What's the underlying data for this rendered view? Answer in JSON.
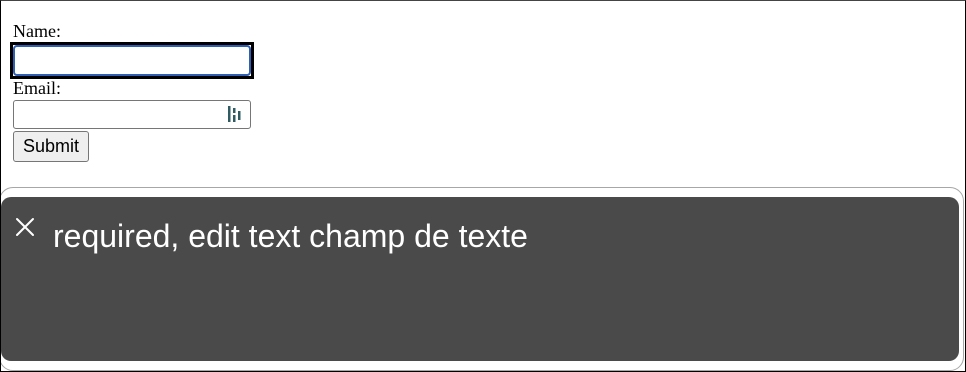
{
  "form": {
    "name_label": "Name:",
    "name_value": "",
    "email_label": "Email:",
    "email_value": "",
    "submit_label": "Submit",
    "autofill_icon": "password-manager-autofill-icon",
    "focus_color": "#2f5fb3"
  },
  "caption": {
    "close_icon": "close-icon",
    "text": "required, edit text champ de texte",
    "background_color": "#4a4a4a"
  }
}
